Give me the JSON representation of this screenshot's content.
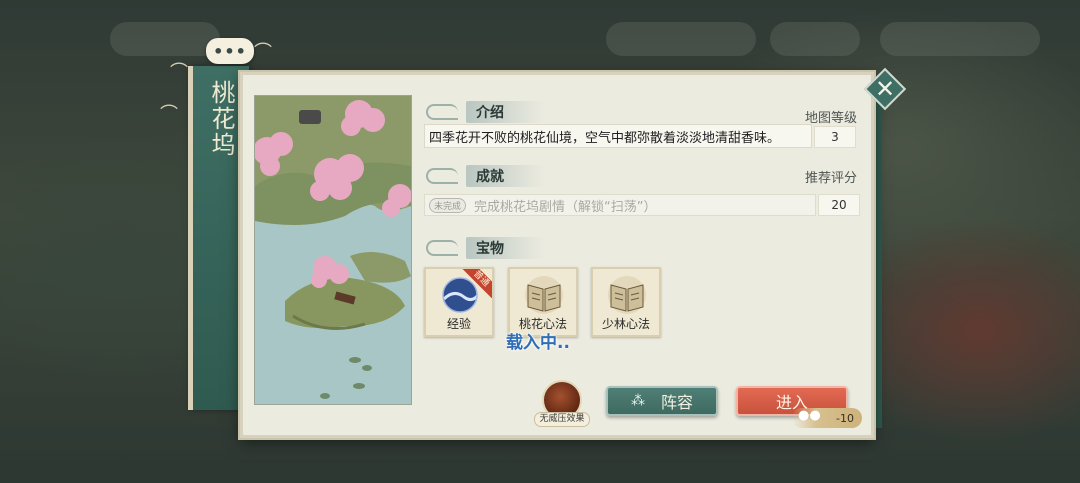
{
  "location": {
    "name": "桃花坞",
    "intro_header": "介绍",
    "description": "四季花开不败的桃花仙境，空气中都弥散着淡淡地清甜香味。",
    "map_level_label": "地图等级",
    "map_level_value": "3",
    "achievement_header": "成就",
    "recommended_label": "推荐评分",
    "recommended_value": "20",
    "achievement_status": "未完成",
    "achievement_text": "完成桃花坞剧情（解锁“扫荡”）",
    "treasure_header": "宝物"
  },
  "treasures": [
    {
      "name": "经验",
      "icon": "experience-orb-icon",
      "badge": "普通"
    },
    {
      "name": "桃花心法",
      "icon": "manual-book-icon"
    },
    {
      "name": "少林心法",
      "icon": "manual-book-icon"
    }
  ],
  "overlay": {
    "loading_text": "载入中.."
  },
  "bottom": {
    "pressure_label": "无威压效果",
    "lineup_label": "阵容",
    "enter_label": "进入",
    "cost_value": "-10"
  },
  "chat_bubble": "•••",
  "colors": {
    "panel_bg": "#ecebe0",
    "banner_green": "#2f5a50",
    "enter_red": "#d95c45",
    "lineup_teal": "#4a7a71",
    "loading_blue": "#2f6eb7"
  }
}
